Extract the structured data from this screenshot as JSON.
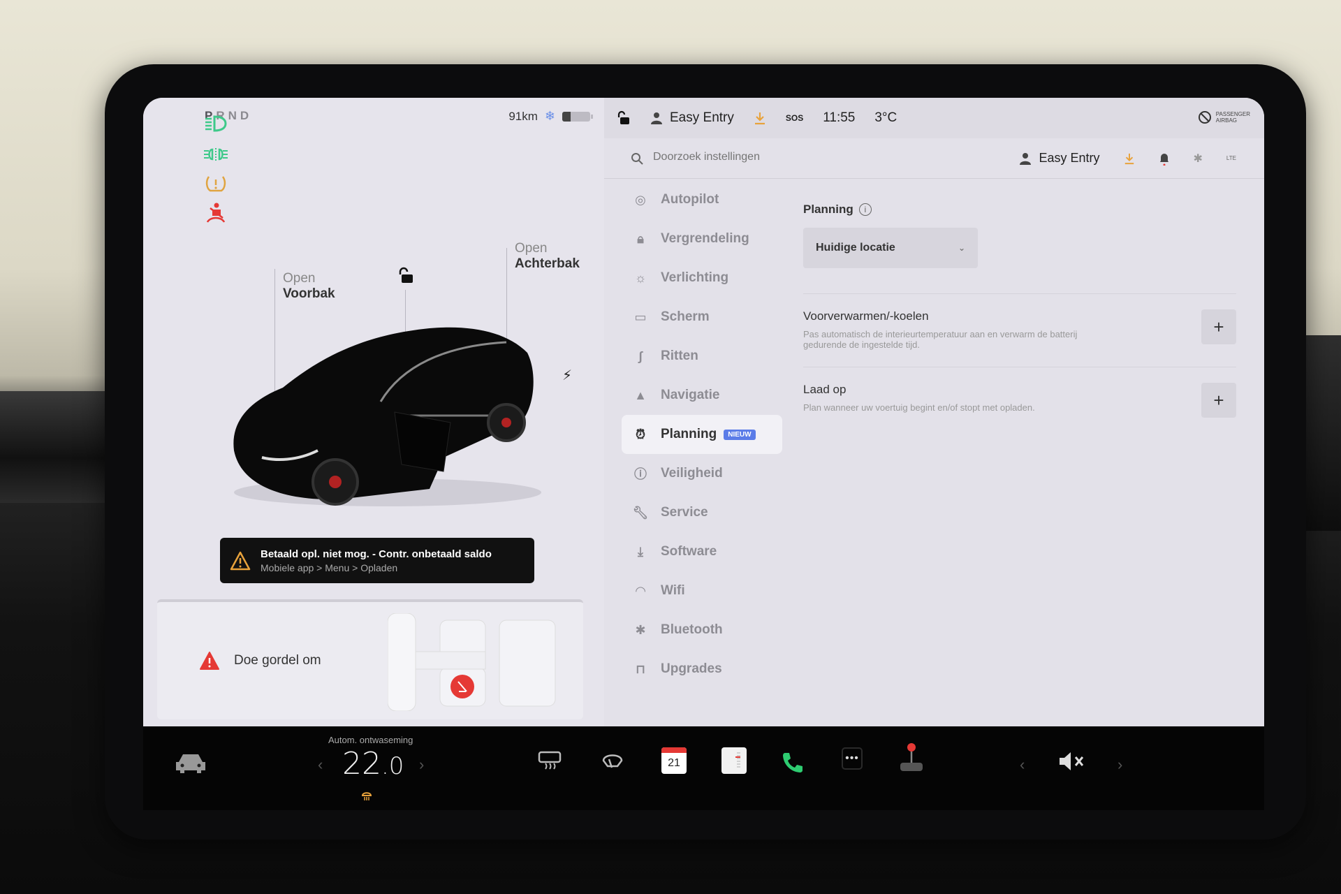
{
  "drive": {
    "gears": [
      "P",
      "R",
      "N",
      "D"
    ],
    "selected": "P"
  },
  "status": {
    "range": "91km",
    "profile": "Easy Entry",
    "sos": "SOS",
    "time": "11:55",
    "temperature": "3°C",
    "airbag_line1": "PASSENGER",
    "airbag_line2": "AIRBAG",
    "network": "LTE"
  },
  "indicators": [
    {
      "icon": "headlight-icon",
      "color": "#3ec98a"
    },
    {
      "icon": "fog-light-icon",
      "color": "#3ec98a"
    },
    {
      "icon": "tire-pressure-icon",
      "color": "#e0a440"
    },
    {
      "icon": "seatbelt-icon",
      "color": "#e53935"
    }
  ],
  "car": {
    "frunk_line1": "Open",
    "frunk_line2": "Voorbak",
    "trunk_line1": "Open",
    "trunk_line2": "Achterbak",
    "charge_icon": "lightning-icon"
  },
  "alerts": {
    "charge_title": "Betaald opl. niet mog. - Contr. onbetaald saldo",
    "charge_sub": "Mobiele app > Menu > Opladen",
    "seatbelt": "Doe gordel om"
  },
  "search": {
    "placeholder": "Doorzoek instellingen"
  },
  "menu": [
    {
      "label": "Autopilot",
      "icon": "steering-wheel-icon"
    },
    {
      "label": "Vergrendeling",
      "icon": "lock-icon"
    },
    {
      "label": "Verlichting",
      "icon": "light-icon"
    },
    {
      "label": "Scherm",
      "icon": "display-icon"
    },
    {
      "label": "Ritten",
      "icon": "trips-icon"
    },
    {
      "label": "Navigatie",
      "icon": "navigation-icon"
    },
    {
      "label": "Planning",
      "icon": "alarm-clock-icon",
      "badge": "NIEUW",
      "active": true
    },
    {
      "label": "Veiligheid",
      "icon": "safety-icon"
    },
    {
      "label": "Service",
      "icon": "wrench-icon"
    },
    {
      "label": "Software",
      "icon": "download-icon"
    },
    {
      "label": "Wifi",
      "icon": "wifi-icon"
    },
    {
      "label": "Bluetooth",
      "icon": "bluetooth-icon"
    },
    {
      "label": "Upgrades",
      "icon": "shopping-bag-icon"
    }
  ],
  "planning": {
    "title": "Planning",
    "location": "Huidige locatie",
    "precondition_title": "Voorverwarmen/-koelen",
    "precondition_desc": "Pas automatisch de interieurtemperatuur aan en verwarm de batterij gedurende de ingestelde tijd.",
    "charge_title": "Laad op",
    "charge_desc": "Plan wanneer uw voertuig begint en/of stopt met opladen.",
    "add_label": "+"
  },
  "dock": {
    "climate_label": "Autom. ontwaseming",
    "temp_whole": "22",
    "temp_decimal": ".0",
    "calendar_day": "21"
  }
}
